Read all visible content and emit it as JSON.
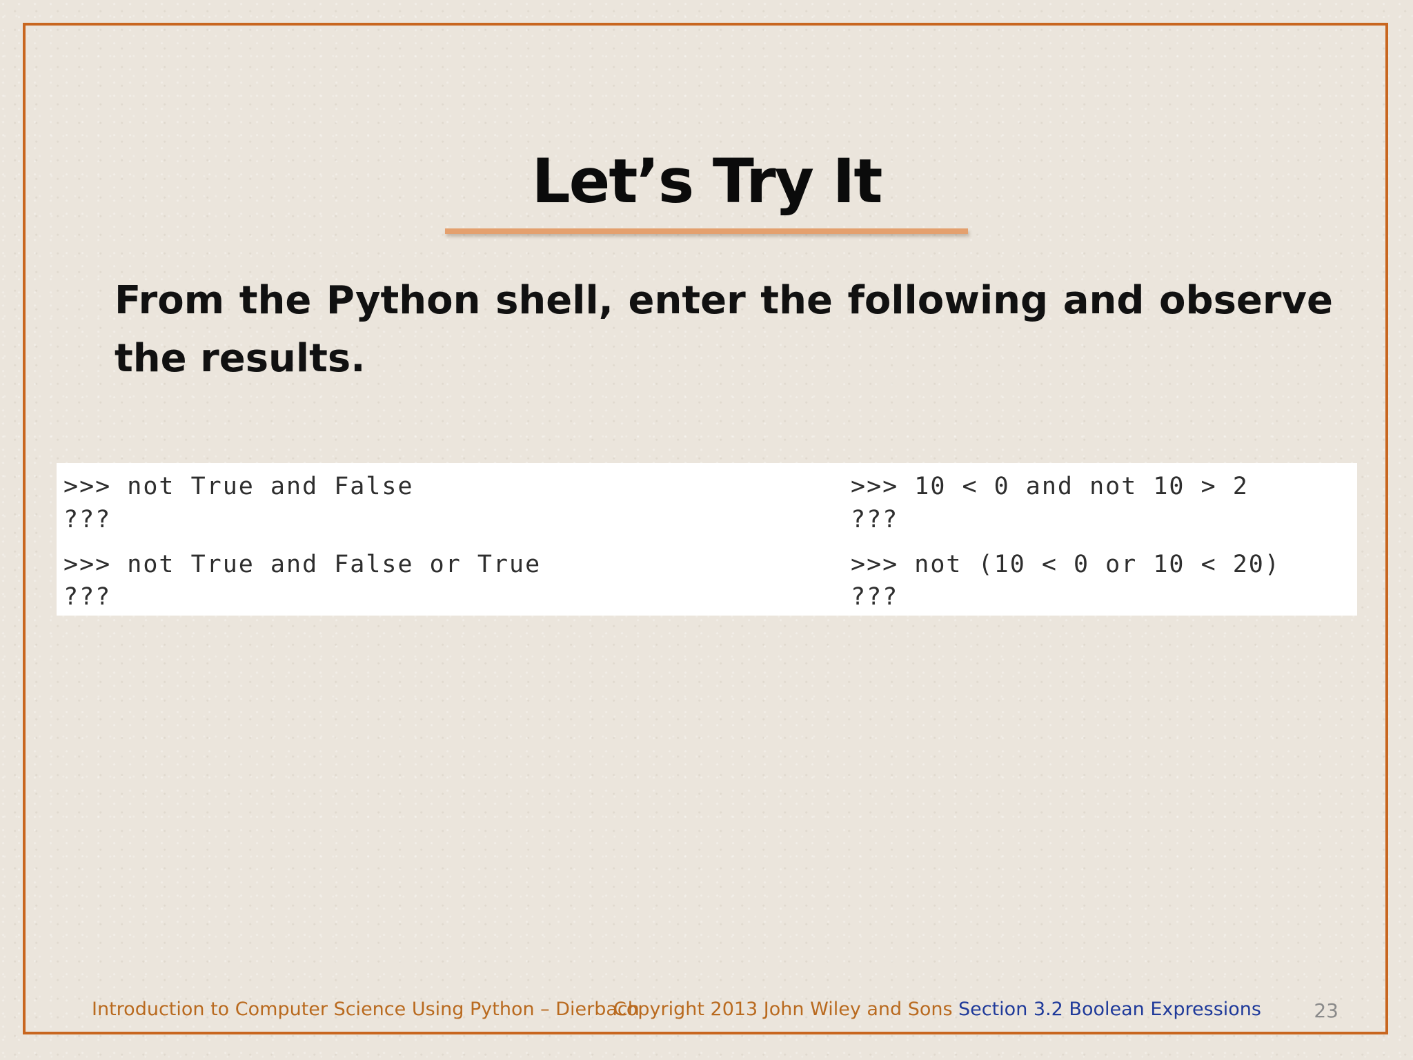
{
  "slide": {
    "title": "Let’s Try It",
    "instruction": "From the Python shell, enter the following and observe the results.",
    "page_number": "23"
  },
  "code_panel": {
    "left_column": [
      {
        "prompt": ">>> not True and False",
        "result": "???"
      },
      {
        "prompt": ">>> not True and False or True",
        "result": "???"
      }
    ],
    "right_column": [
      {
        "prompt": ">>> 10 < 0 and not 10 > 2",
        "result": "???"
      },
      {
        "prompt": ">>> not (10 < 0 or 10 < 20)",
        "result": "???"
      }
    ]
  },
  "footer": {
    "book": "Introduction to Computer Science Using Python – Dierbach",
    "copyright": "Copyright 2013 John Wiley and  Sons",
    "section": "Section 3.2 Boolean Expressions"
  },
  "colors": {
    "border": "#c8661f",
    "underline": "#e4a06e",
    "footer_orange": "#b96a1f",
    "footer_blue": "#1f3a9a"
  }
}
